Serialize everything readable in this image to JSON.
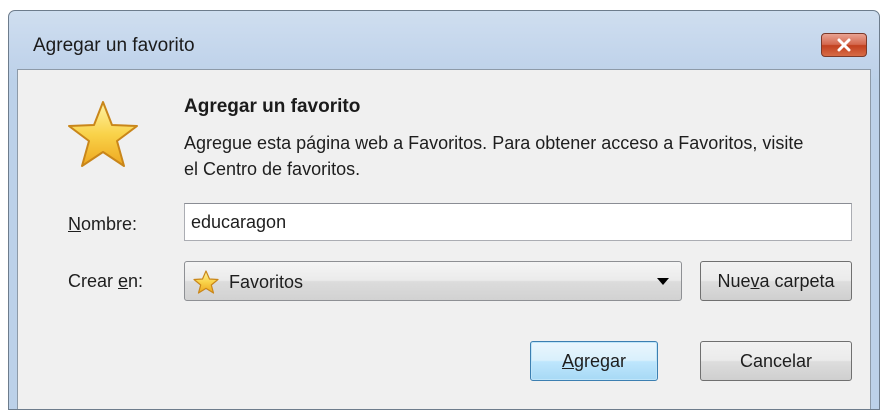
{
  "window": {
    "title": "Agregar un favorito",
    "close_icon": "close-icon"
  },
  "header": {
    "icon": "star-icon",
    "heading": "Agregar un favorito",
    "description": "Agregue esta página web a Favoritos. Para obtener acceso a Favoritos, visite el Centro de favoritos."
  },
  "form": {
    "name_label": {
      "accel": "N",
      "rest": "ombre:"
    },
    "name_value": "educaragon",
    "create_label": {
      "before": "Crear ",
      "accel": "e",
      "after": "n:"
    },
    "create_value": "Favoritos",
    "create_icon": "star-icon",
    "new_folder_button": {
      "before": "Nue",
      "accel": "v",
      "after": "a carpeta"
    }
  },
  "actions": {
    "add_button": {
      "accel": "A",
      "rest": "gregar"
    },
    "cancel_button": "Cancelar"
  },
  "colors": {
    "titlebar": "#c4d6ec",
    "close": "#c2401f",
    "default_button_border": "#3c7fb1",
    "star": "#f7c532"
  }
}
